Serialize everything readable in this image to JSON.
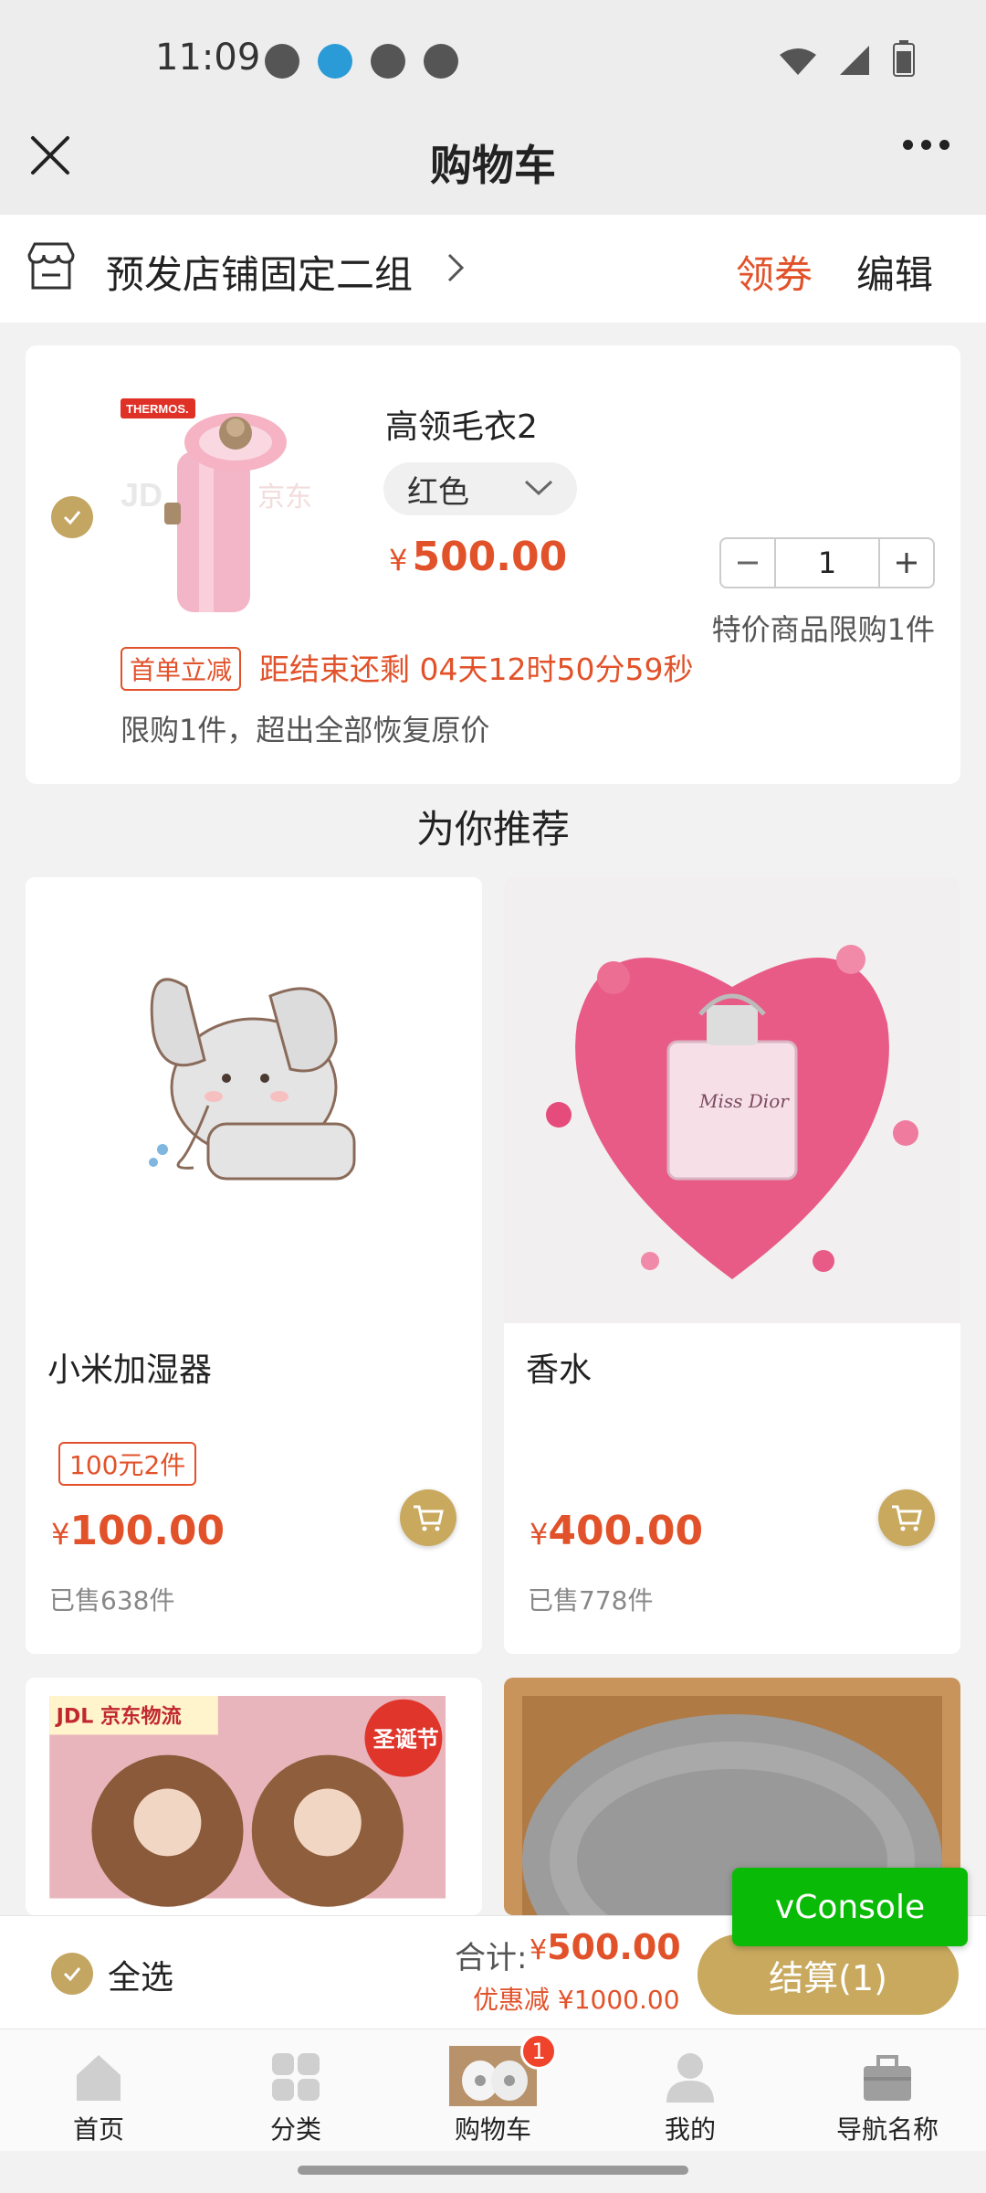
{
  "status_bar": {
    "time": "11:09"
  },
  "header": {
    "title": "购物车"
  },
  "store": {
    "name": "预发店铺固定二组",
    "coupon_label": "领券",
    "edit_label": "编辑"
  },
  "cart_item": {
    "name": "高领毛衣2",
    "variant": "红色",
    "price_currency": "¥",
    "price": "500.00",
    "quantity": "1",
    "limit_note": "特价商品限购1件",
    "promo_tag": "首单立减",
    "countdown": "距结束还剩 04天12时50分59秒",
    "limit_desc": "限购1件，超出全部恢复原价",
    "image_brand": "THERMOS."
  },
  "recommend": {
    "title": "为你推荐",
    "items": [
      {
        "name": "小米加湿器",
        "tag": "100元2件",
        "currency": "¥",
        "price": "100.00",
        "sold": "已售638件"
      },
      {
        "name": "香水",
        "tag": "",
        "currency": "¥",
        "price": "400.00",
        "sold": "已售778件"
      },
      {
        "image_badge_left": "JDL 京东物流",
        "image_badge_right": "圣诞节"
      },
      {}
    ]
  },
  "checkout": {
    "select_all": "全选",
    "total_label": "合计:",
    "total_currency": "¥",
    "total": "500.00",
    "discount": "优惠减 ¥1000.00",
    "pay_label": "结算(1)"
  },
  "vconsole": {
    "label": "vConsole"
  },
  "tabbar": {
    "items": [
      {
        "label": "首页"
      },
      {
        "label": "分类"
      },
      {
        "label": "购物车",
        "badge": "1"
      },
      {
        "label": "我的"
      },
      {
        "label": "导航名称"
      }
    ]
  },
  "colors": {
    "accent": "#e2522a",
    "gold": "#c9a95e",
    "vconsole": "#09bb07"
  }
}
